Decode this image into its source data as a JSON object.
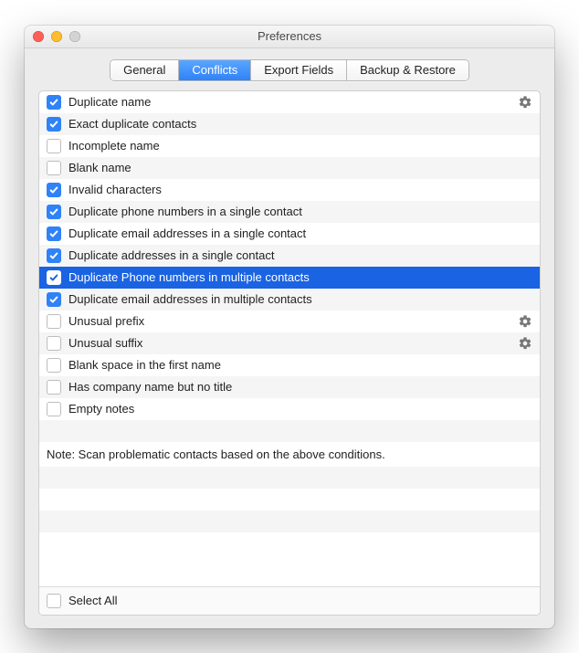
{
  "window": {
    "title": "Preferences"
  },
  "tabs": {
    "general": "General",
    "conflicts": "Conflicts",
    "exportFields": "Export Fields",
    "backupRestore": "Backup & Restore",
    "activeIndex": 1
  },
  "conflicts": {
    "items": [
      {
        "label": "Duplicate name",
        "checked": true,
        "gear": true
      },
      {
        "label": "Exact duplicate contacts",
        "checked": true,
        "gear": false
      },
      {
        "label": "Incomplete name",
        "checked": false,
        "gear": false
      },
      {
        "label": "Blank name",
        "checked": false,
        "gear": false
      },
      {
        "label": "Invalid characters",
        "checked": true,
        "gear": false
      },
      {
        "label": "Duplicate phone numbers in a single contact",
        "checked": true,
        "gear": false
      },
      {
        "label": "Duplicate email addresses in a single contact",
        "checked": true,
        "gear": false
      },
      {
        "label": "Duplicate addresses in a single contact",
        "checked": true,
        "gear": false
      },
      {
        "label": "Duplicate Phone numbers in multiple contacts",
        "checked": true,
        "gear": false,
        "selected": true
      },
      {
        "label": "Duplicate email addresses in multiple contacts",
        "checked": true,
        "gear": false
      },
      {
        "label": "Unusual prefix",
        "checked": false,
        "gear": true
      },
      {
        "label": "Unusual suffix",
        "checked": false,
        "gear": true
      },
      {
        "label": "Blank space in the first name",
        "checked": false,
        "gear": false
      },
      {
        "label": "Has company name but no title",
        "checked": false,
        "gear": false
      },
      {
        "label": "Empty notes",
        "checked": false,
        "gear": false
      }
    ],
    "note": "Note: Scan problematic contacts based on the above conditions.",
    "selectAll": {
      "label": "Select All",
      "checked": false
    }
  }
}
